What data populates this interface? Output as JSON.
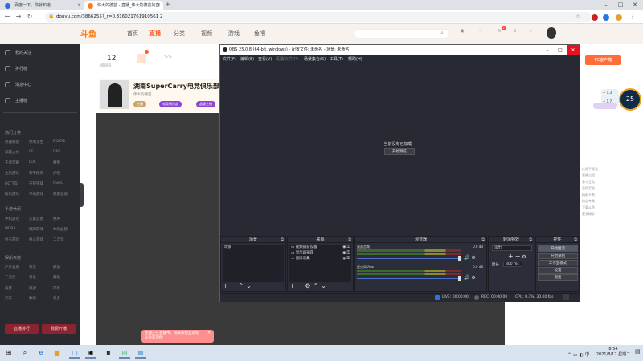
{
  "browser": {
    "tabs": [
      {
        "title": "百度一下，你就知道",
        "favicon_color": "#2b6be0"
      },
      {
        "title": "伟大的德芸 - 直播_伟大的德芸的直",
        "favicon_color": "#ff7a1a"
      }
    ],
    "new_tab": "+",
    "url": "douyu.com/3866255?_r=0.316021761910561 2",
    "window_min": "–",
    "window_max": "□",
    "window_close": "✕"
  },
  "douyu": {
    "logo": "斗鱼",
    "nav": [
      "首页",
      "直播",
      "分类",
      "视频",
      "游戏",
      "鱼吧"
    ],
    "search_placeholder": "",
    "room_num": "12",
    "room_num_label": "房间号",
    "room_title": "湖南SuperCarry电竞俱乐部直播",
    "anchor_name": "伟大的德芸",
    "tags": [
      "主播",
      "电竞俱乐部",
      "超级主播"
    ],
    "pc_button": "PC客户端",
    "speed": "25",
    "speed_tip_lines": [
      "+ 1.3",
      "+ 1.7"
    ],
    "toast": [
      "主播正在直播中，快来和他互动吧",
      "斗鱼欢迎你"
    ],
    "right_text": [
      "仅限于观看",
      "直播过程",
      "参与互动",
      "获得奖励",
      "精彩不断",
      "粉丝专属",
      "下载斗鱼",
      "更多精彩"
    ]
  },
  "sidebar": {
    "items": [
      "我的关注",
      "排行榜",
      "消息中心",
      "主播榜"
    ],
    "section1": "热门分类",
    "section2": "手游休闲",
    "section3": "娱乐天地",
    "grid1": [
      "英雄联盟",
      "绝地求生",
      "DOTA2",
      "穿越火线",
      "CF",
      "DNF",
      "王者荣耀",
      "LOL",
      "魔兽",
      "主机游戏",
      "和平精英",
      "炉石",
      "QQ飞车",
      "守望先锋",
      "CSGO",
      "街机游戏",
      "单机游戏",
      "网游竞技"
    ],
    "grid2": [
      "手机游戏",
      "火影忍者",
      "原神",
      "MOBA",
      "棋牌游戏",
      "休闲益智",
      "射击游戏",
      "格斗游戏",
      "二次元"
    ],
    "grid3": [
      "户外直播",
      "科普",
      "颜值",
      "二次元",
      "音乐",
      "舞蹈",
      "美食",
      "旅游",
      "体育",
      "汽车",
      "数码",
      "更多"
    ],
    "btn_left": "直播排行",
    "btn_right": "我要开播"
  },
  "obs": {
    "title": "OBS 25.0.8 (64-bit, windows) - 配置文件: 未命名 - 场景: 未命名",
    "menu": [
      "文件(F)",
      "编辑(E)",
      "查看(V)",
      "配置文件(P)",
      "场景集合(S)",
      "工具(T)",
      "帮助(H)"
    ],
    "no_scene": "当前没有已加载",
    "start_preview": "开始预览",
    "docks": {
      "scenes": "场景",
      "sources": "来源",
      "mixer": "混音器",
      "transitions": "转场特效",
      "controls": "控件"
    },
    "scene_items": [
      "场景"
    ],
    "source_items": [
      "视频捕获设备",
      "显示器捕获",
      "窗口采集"
    ],
    "mixer_rows": [
      {
        "name": "桌面音频",
        "db": "0.0 dB"
      },
      {
        "name": "麦克风/Aux",
        "db": "0.0 dB"
      }
    ],
    "transition": {
      "label": "淡出",
      "duration_label": "时长",
      "duration": "300 ms"
    },
    "controls": [
      "开始推流",
      "开始录制",
      "工作室模式",
      "设置",
      "退出"
    ],
    "status": {
      "live": "LIVE: 00:00:00",
      "rec": "REC: 00:00:00",
      "cpu": "CPU: 0.3%, 30.00 fps"
    }
  },
  "taskbar": {
    "time": "8:54",
    "date": "2021/8/17 星期二"
  }
}
